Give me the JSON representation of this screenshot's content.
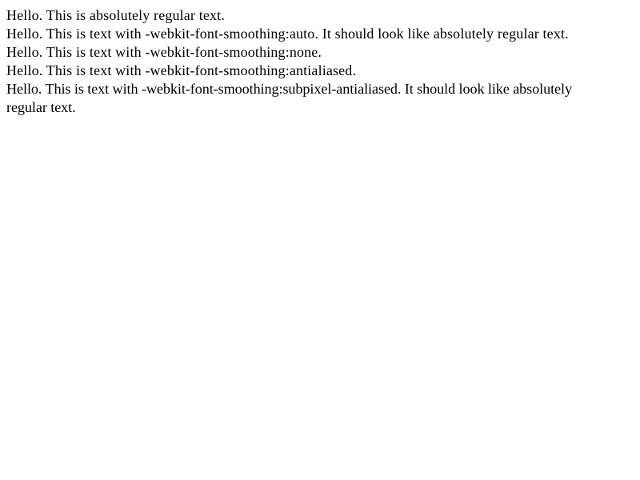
{
  "lines": [
    "Hello. This is absolutely regular text.",
    "Hello. This is text with -webkit-font-smoothing:auto. It should look like absolutely regular text.",
    "Hello. This is text with -webkit-font-smoothing:none.",
    "Hello. This is text with -webkit-font-smoothing:antialiased.",
    "Hello. This is text with -webkit-font-smoothing:subpixel-antialiased. It should look like absolutely regular text."
  ]
}
